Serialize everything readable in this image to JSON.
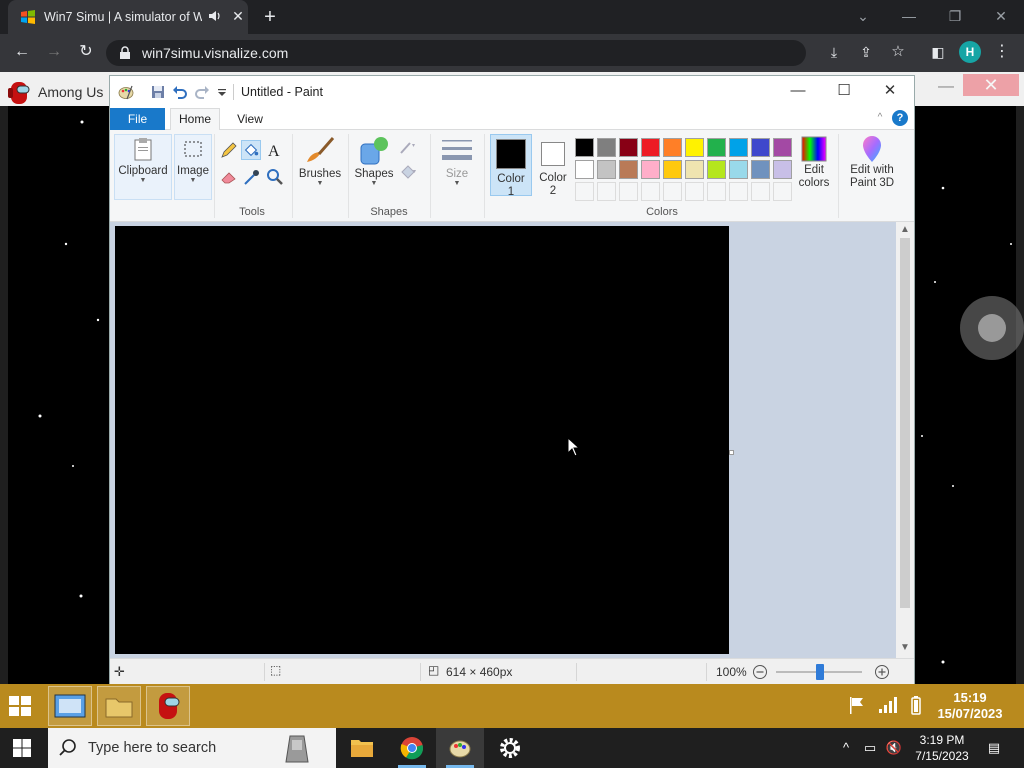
{
  "browser": {
    "tab_title": "Win7 Simu | A simulator of W",
    "url": "win7simu.visnalize.com",
    "profile_initial": "H"
  },
  "sim_desktop": {
    "background_app_label": "Among Us",
    "taskbar_time": "15:19",
    "taskbar_date": "15/07/2023"
  },
  "paint": {
    "window_title": "Untitled - Paint",
    "tabs": {
      "file": "File",
      "home": "Home",
      "view": "View"
    },
    "groups": {
      "clipboard": "Clipboard",
      "image": "Image",
      "tools": "Tools",
      "brushes": "Brushes",
      "shapes_btn": "Shapes",
      "shapes_group": "Shapes",
      "size": "Size",
      "color1_l1": "Color",
      "color1_l2": "1",
      "color2_l1": "Color",
      "color2_l2": "2",
      "colors": "Colors",
      "edit_colors_l1": "Edit",
      "edit_colors_l2": "colors",
      "paint3d_l1": "Edit with",
      "paint3d_l2": "Paint 3D"
    },
    "palette_row1": [
      "#000000",
      "#7f7f7f",
      "#880015",
      "#ed1c24",
      "#ff7f27",
      "#fff200",
      "#22b14c",
      "#00a2e8",
      "#3f48cc",
      "#a349a4"
    ],
    "palette_row2": [
      "#ffffff",
      "#c3c3c3",
      "#b97a57",
      "#ffaec9",
      "#ffc90e",
      "#efe4b0",
      "#b5e61d",
      "#99d9ea",
      "#7092be",
      "#c8bfe7"
    ],
    "color1": "#000000",
    "color2": "#ffffff",
    "status": {
      "dimensions": "614 × 460px",
      "zoom": "100%"
    }
  },
  "windows": {
    "search_placeholder": "Type here to search",
    "time": "3:19 PM",
    "date": "7/15/2023"
  }
}
